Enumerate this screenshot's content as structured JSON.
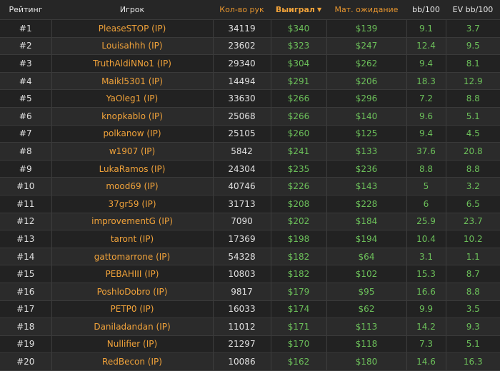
{
  "columns": {
    "rank": "Рейтинг",
    "player": "Игрок",
    "hands": "Кол-во рук",
    "won": "Выиграл",
    "ev": "Мат. ожидание",
    "bb100": "bb/100",
    "evbb100": "EV bb/100"
  },
  "sort": {
    "column": "won",
    "direction": "desc"
  },
  "colors": {
    "accent": "#f0a23a",
    "positive": "#6cc05a",
    "background": "#2a2a2a"
  },
  "rows": [
    {
      "rank": "#1",
      "player": "PleaseSTOP (IP)",
      "hands": "34119",
      "won": "$340",
      "ev": "$139",
      "bb100": "9.1",
      "evbb100": "3.7"
    },
    {
      "rank": "#2",
      "player": "Louisahhh (IP)",
      "hands": "23602",
      "won": "$323",
      "ev": "$247",
      "bb100": "12.4",
      "evbb100": "9.5"
    },
    {
      "rank": "#3",
      "player": "TruthAldiNNo1 (IP)",
      "hands": "29340",
      "won": "$304",
      "ev": "$262",
      "bb100": "9.4",
      "evbb100": "8.1"
    },
    {
      "rank": "#4",
      "player": "Maikl5301 (IP)",
      "hands": "14494",
      "won": "$291",
      "ev": "$206",
      "bb100": "18.3",
      "evbb100": "12.9"
    },
    {
      "rank": "#5",
      "player": "YaOleg1 (IP)",
      "hands": "33630",
      "won": "$266",
      "ev": "$296",
      "bb100": "7.2",
      "evbb100": "8.8"
    },
    {
      "rank": "#6",
      "player": "knopkablo (IP)",
      "hands": "25068",
      "won": "$266",
      "ev": "$140",
      "bb100": "9.6",
      "evbb100": "5.1"
    },
    {
      "rank": "#7",
      "player": "polkanow (IP)",
      "hands": "25105",
      "won": "$260",
      "ev": "$125",
      "bb100": "9.4",
      "evbb100": "4.5"
    },
    {
      "rank": "#8",
      "player": "w1907 (IP)",
      "hands": "5842",
      "won": "$241",
      "ev": "$133",
      "bb100": "37.6",
      "evbb100": "20.8"
    },
    {
      "rank": "#9",
      "player": "LukaRamos (IP)",
      "hands": "24304",
      "won": "$235",
      "ev": "$236",
      "bb100": "8.8",
      "evbb100": "8.8"
    },
    {
      "rank": "#10",
      "player": "mood69 (IP)",
      "hands": "40746",
      "won": "$226",
      "ev": "$143",
      "bb100": "5",
      "evbb100": "3.2"
    },
    {
      "rank": "#11",
      "player": "37gr59 (IP)",
      "hands": "31713",
      "won": "$208",
      "ev": "$228",
      "bb100": "6",
      "evbb100": "6.5"
    },
    {
      "rank": "#12",
      "player": "improvementG (IP)",
      "hands": "7090",
      "won": "$202",
      "ev": "$184",
      "bb100": "25.9",
      "evbb100": "23.7"
    },
    {
      "rank": "#13",
      "player": "taront (IP)",
      "hands": "17369",
      "won": "$198",
      "ev": "$194",
      "bb100": "10.4",
      "evbb100": "10.2"
    },
    {
      "rank": "#14",
      "player": "gattomarrone (IP)",
      "hands": "54328",
      "won": "$182",
      "ev": "$64",
      "bb100": "3.1",
      "evbb100": "1.1"
    },
    {
      "rank": "#15",
      "player": "PEBAHIII (IP)",
      "hands": "10803",
      "won": "$182",
      "ev": "$102",
      "bb100": "15.3",
      "evbb100": "8.7"
    },
    {
      "rank": "#16",
      "player": "PoshloDobro (IP)",
      "hands": "9817",
      "won": "$179",
      "ev": "$95",
      "bb100": "16.6",
      "evbb100": "8.8"
    },
    {
      "rank": "#17",
      "player": "PETP0 (IP)",
      "hands": "16033",
      "won": "$174",
      "ev": "$62",
      "bb100": "9.9",
      "evbb100": "3.5"
    },
    {
      "rank": "#18",
      "player": "Daniladandan (IP)",
      "hands": "11012",
      "won": "$171",
      "ev": "$113",
      "bb100": "14.2",
      "evbb100": "9.3"
    },
    {
      "rank": "#19",
      "player": "Nullifier (IP)",
      "hands": "21297",
      "won": "$170",
      "ev": "$118",
      "bb100": "7.3",
      "evbb100": "5.1"
    },
    {
      "rank": "#20",
      "player": "RedBecon (IP)",
      "hands": "10086",
      "won": "$162",
      "ev": "$180",
      "bb100": "14.6",
      "evbb100": "16.3"
    }
  ]
}
